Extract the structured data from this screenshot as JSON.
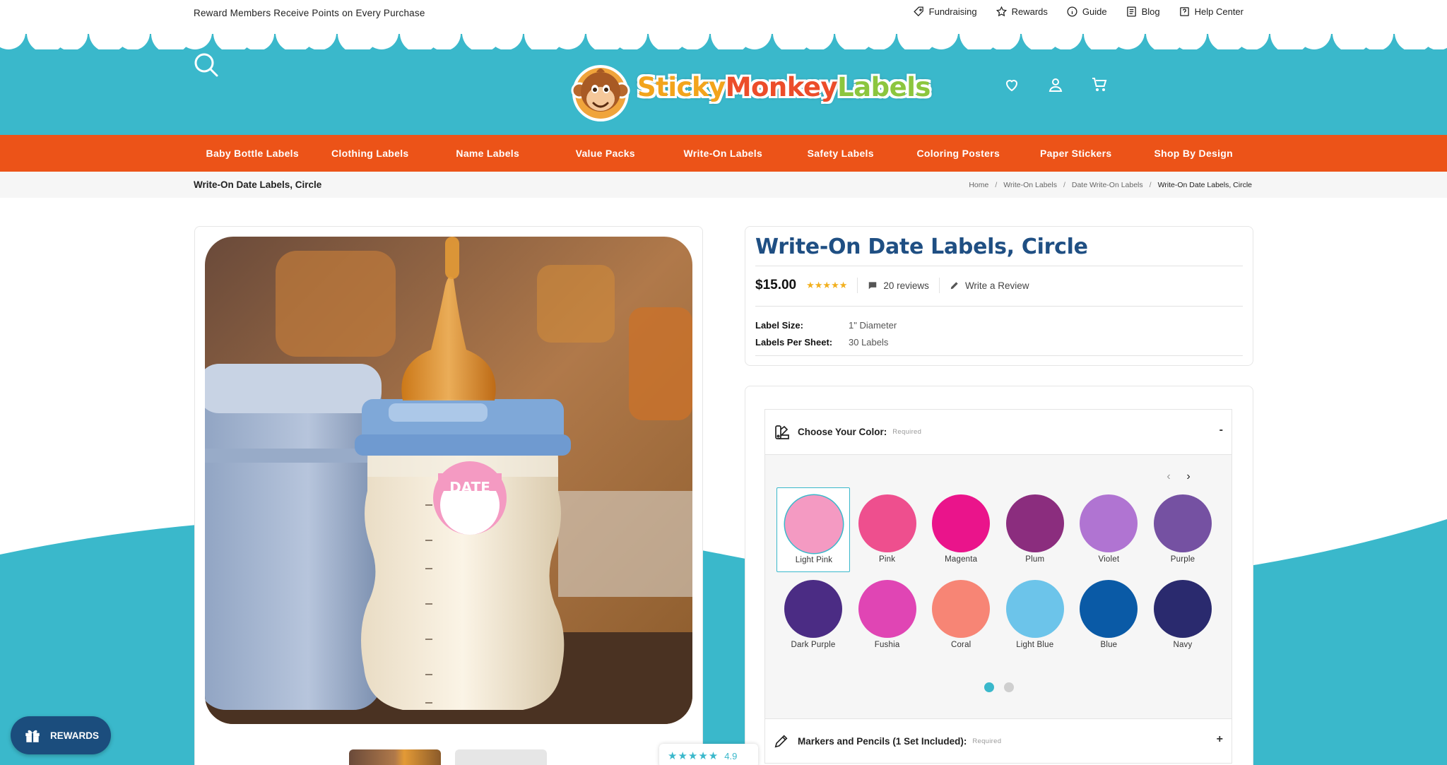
{
  "topbar": {
    "promo": "Reward Members Receive Points on Every Purchase",
    "links": [
      {
        "label": "Fundraising",
        "icon": "tag-icon"
      },
      {
        "label": "Rewards",
        "icon": "star-icon"
      },
      {
        "label": "Guide",
        "icon": "info-icon"
      },
      {
        "label": "Blog",
        "icon": "blog-icon"
      },
      {
        "label": "Help Center",
        "icon": "help-icon"
      }
    ]
  },
  "header": {
    "logo_text": "StickyMonkeyLabels",
    "icons": [
      "search-icon",
      "heart-icon",
      "account-icon",
      "cart-icon"
    ]
  },
  "nav": {
    "items": [
      "Baby Bottle Labels",
      "Clothing Labels",
      "Name Labels",
      "Value Packs",
      "Write-On Labels",
      "Safety Labels",
      "Coloring Posters",
      "Paper Stickers",
      "Shop By Design"
    ]
  },
  "breadcrumb": {
    "page_name": "Write-On Date Labels, Circle",
    "items": [
      "Home",
      "Write-On Labels",
      "Date Write-On Labels",
      "Write-On Date Labels, Circle"
    ],
    "separator": "/"
  },
  "product": {
    "title": "Write-On Date Labels, Circle",
    "price": "$15.00",
    "stars": "★★★★★",
    "reviews": "20 reviews",
    "write_review": "Write a Review",
    "specs": [
      {
        "label": "Label Size:",
        "value": "1\" Diameter"
      },
      {
        "label": "Labels Per Sheet:",
        "value": "30 Labels"
      }
    ],
    "image_label_text": "DATE"
  },
  "options": {
    "color": {
      "title": "Choose Your Color:",
      "required": "Required",
      "toggle": "-",
      "swatches": [
        {
          "name": "Light Pink",
          "color": "#f49ac2",
          "selected": true
        },
        {
          "name": "Pink",
          "color": "#ee4f8e"
        },
        {
          "name": "Magenta",
          "color": "#ea148b"
        },
        {
          "name": "Plum",
          "color": "#8b2d7e"
        },
        {
          "name": "Violet",
          "color": "#b074d2"
        },
        {
          "name": "Purple",
          "color": "#7551a2"
        },
        {
          "name": "Dark Purple",
          "color": "#4b2c84"
        },
        {
          "name": "Fushia",
          "color": "#e045b4"
        },
        {
          "name": "Coral",
          "color": "#f78575"
        },
        {
          "name": "Light Blue",
          "color": "#6cc4ea"
        },
        {
          "name": "Blue",
          "color": "#0a5aa6"
        },
        {
          "name": "Navy",
          "color": "#2a2a6e"
        }
      ],
      "pager_pages": 2,
      "pager_active": 1
    },
    "markers": {
      "title": "Markers and Pencils (1 Set Included):",
      "required": "Required",
      "toggle": "+"
    }
  },
  "widgets": {
    "rewards_label": "REWARDS",
    "rating_stars": "★★★★★",
    "rating_value": "4.9"
  },
  "colors": {
    "teal": "#3ab8cb",
    "orange": "#ec5318",
    "title_blue": "#1f4f83",
    "rewards_navy": "#1b4d7d"
  }
}
